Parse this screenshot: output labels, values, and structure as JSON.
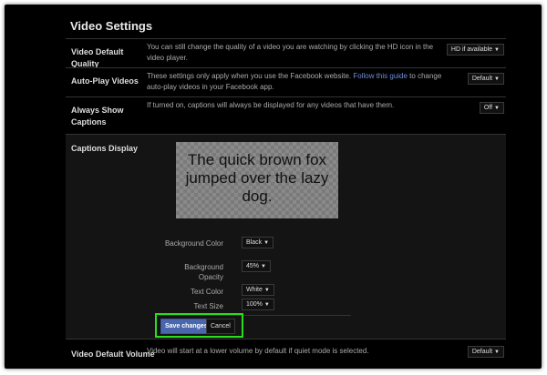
{
  "title": "Video Settings",
  "rows": [
    {
      "label": "Video Default Quality",
      "desc": "You can still change the quality of a video you are watching by clicking the HD icon in the video player.",
      "value": "HD if available"
    },
    {
      "label": "Auto-Play Videos",
      "desc_before": "These settings only apply when you use the Facebook website. ",
      "link": "Follow this guide",
      "desc_after": " to change auto-play videos in your Facebook app.",
      "value": "Default"
    },
    {
      "label": "Always Show Captions",
      "desc": "If turned on, captions will always be displayed for any videos that have them.",
      "value": "Off"
    }
  ],
  "captions": {
    "label": "Captions Display",
    "preview": "The quick brown fox jumped over the lazy dog.",
    "fields": [
      {
        "label": "Background Color",
        "value": "Black"
      },
      {
        "label": "Background Opacity",
        "value": "45%"
      },
      {
        "label": "Text Color",
        "value": "White"
      },
      {
        "label": "Text Size",
        "value": "100%"
      }
    ],
    "save": "Save changes",
    "cancel": "Cancel"
  },
  "volume": {
    "label": "Video Default Volume",
    "desc": "Video will start at a lower volume by default if quiet mode is selected.",
    "value": "Default"
  },
  "highlight_color": "#2ddc1e"
}
